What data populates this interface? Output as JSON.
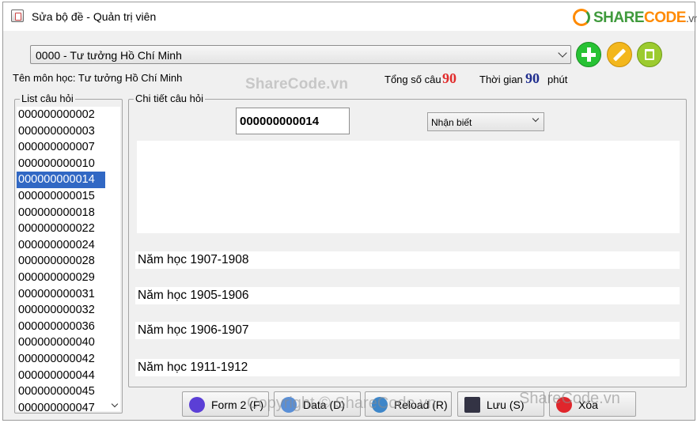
{
  "window": {
    "title": "Sửa bộ đề - Quản trị viên",
    "logo": {
      "brand_main": "SHARE",
      "brand_accent": "CODE",
      "brand_tld": ".vn"
    }
  },
  "subject": {
    "selected": "0000 - Tư tưởng Hồ Chí Minh",
    "label": "Tên môn học:",
    "name": "Tư tưởng Hồ Chí Minh"
  },
  "toolbar": {
    "add_icon": "plus-icon",
    "edit_icon": "pencil-icon",
    "delete_icon": "trash-icon"
  },
  "stats": {
    "count_label": "Tổng số câu",
    "count_value": "90",
    "time_label": "Thời gian",
    "time_value": "90",
    "time_unit": "phút"
  },
  "watermarks": {
    "center": "ShareCode.vn",
    "bottom": "Copyright © ShareCode.vn",
    "right": "ShareCode.vn"
  },
  "list": {
    "title": "List câu hỏi",
    "items": [
      "000000000002",
      "000000000003",
      "000000000007",
      "000000000010",
      "000000000014",
      "000000000015",
      "000000000018",
      "000000000022",
      "000000000024",
      "000000000028",
      "000000000029",
      "000000000031",
      "000000000032",
      "000000000036",
      "000000000040",
      "000000000042",
      "000000000044",
      "000000000045",
      "000000000047"
    ],
    "selected_index": 4
  },
  "detail": {
    "title": "Chi tiết câu hỏi",
    "question_id": "000000000014",
    "level": "Nhận biết",
    "answers": [
      "Năm học 1907-1908",
      "Năm học 1905-1906",
      "Năm học 1906-1907",
      "Năm học 1911-1912"
    ]
  },
  "buttons": {
    "form2": "Form 2 (F)",
    "data": "Data (D)",
    "reload": "Reload (R)",
    "save": "Lưu (S)",
    "delete": "Xóa"
  }
}
